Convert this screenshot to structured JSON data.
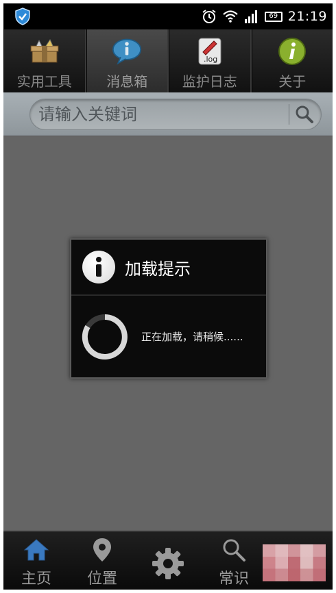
{
  "statusbar": {
    "time": "21:19",
    "battery_level": "69"
  },
  "tabs": [
    {
      "label": "实用工具",
      "icon": "toolbox-icon",
      "active": false
    },
    {
      "label": "消息箱",
      "icon": "message-info-icon",
      "active": true
    },
    {
      "label": "监护日志",
      "icon": "log-file-icon",
      "active": false
    },
    {
      "label": "关于",
      "icon": "about-info-icon",
      "active": false
    }
  ],
  "search": {
    "placeholder": "请输入关键词"
  },
  "dialog": {
    "title": "加载提示",
    "message": "正在加载，请稍候......"
  },
  "bottomnav": [
    {
      "label": "主页",
      "icon": "home-icon"
    },
    {
      "label": "位置",
      "icon": "location-pin-icon"
    },
    {
      "label": "",
      "icon": "gear-icon"
    },
    {
      "label": "常识",
      "icon": "search-icon"
    }
  ]
}
